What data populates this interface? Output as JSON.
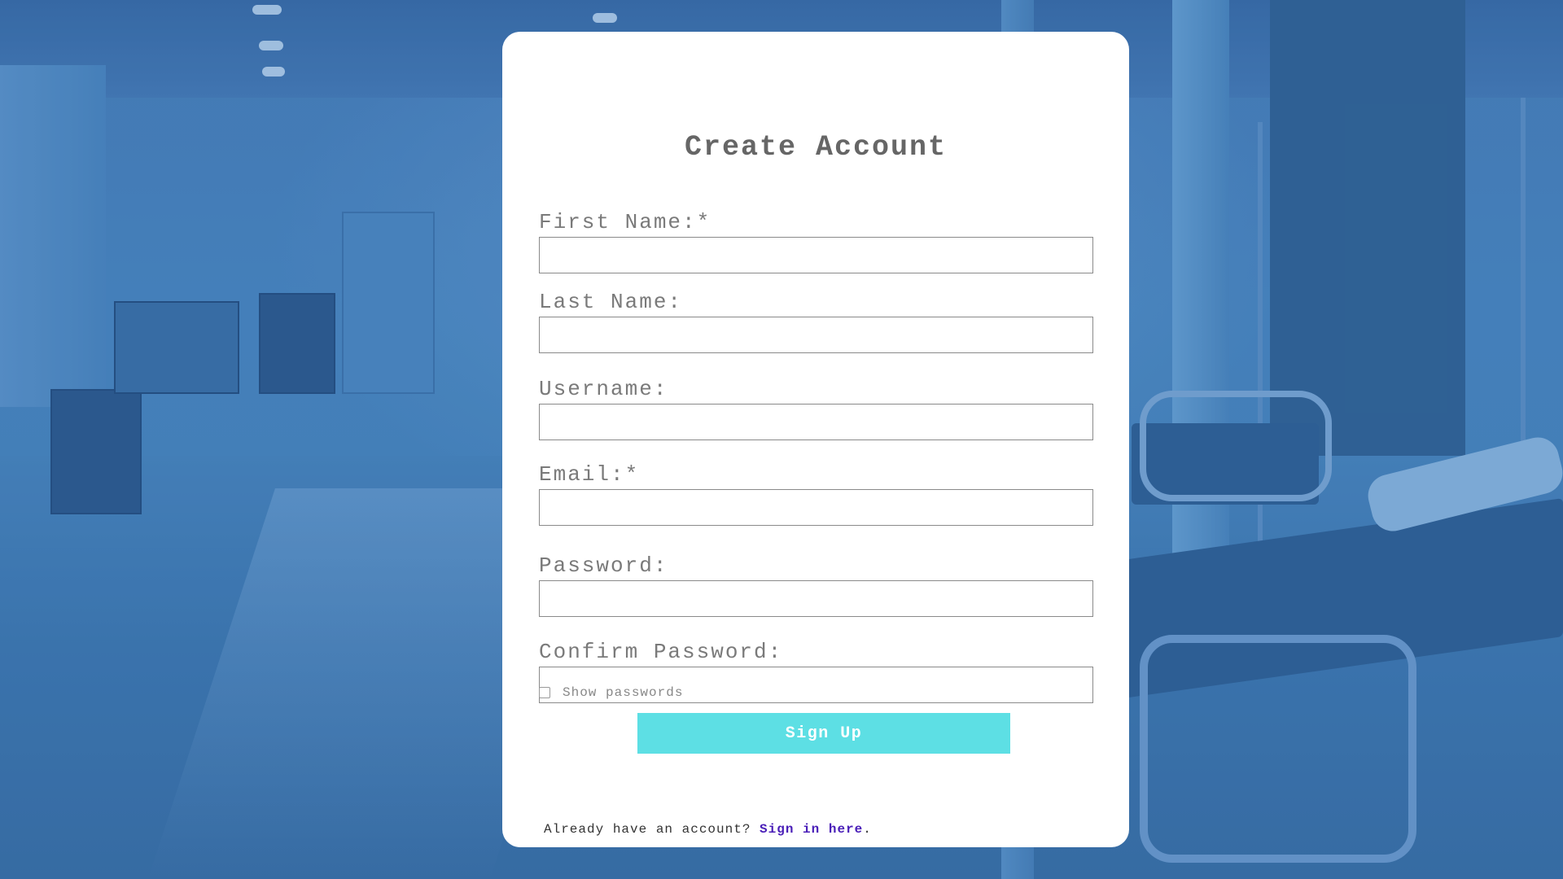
{
  "form": {
    "title": "Create Account",
    "fields": [
      {
        "label": "First Name:*",
        "value": "",
        "type": "text"
      },
      {
        "label": "Last Name:",
        "value": "",
        "type": "text"
      },
      {
        "label": "Username:",
        "value": "",
        "type": "text"
      },
      {
        "label": "Email:*",
        "value": "",
        "type": "email"
      },
      {
        "label": "Password:",
        "value": "",
        "type": "password"
      },
      {
        "label": "Confirm Password:",
        "value": "",
        "type": "password"
      }
    ],
    "show_passwords_label": "Show passwords",
    "show_passwords_checked": false,
    "submit_label": "Sign Up",
    "signin_prompt": "Already have an account? ",
    "signin_link": "Sign in here",
    "signin_suffix": "."
  },
  "colors": {
    "background_tint": "#3f72a8",
    "card": "#ffffff",
    "button": "#5ddfe4",
    "link": "#4a1fb8",
    "label": "#7a7a7a",
    "title": "#666666"
  }
}
